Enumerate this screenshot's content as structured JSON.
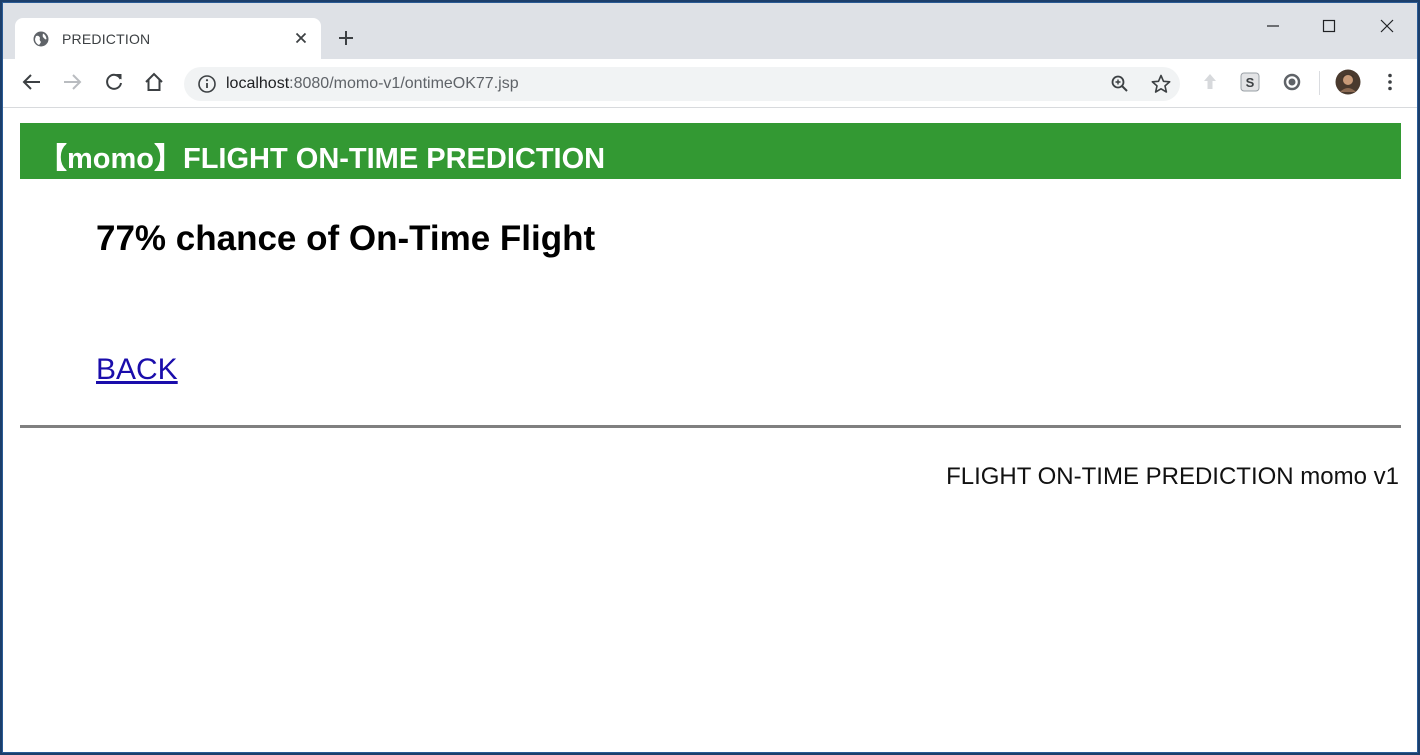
{
  "browser": {
    "tab": {
      "title": "PREDICTION",
      "favicon": "globe-icon"
    },
    "url": {
      "host": "localhost",
      "path": ":8080/momo-v1/ontimeOK77.jsp"
    },
    "toolbar_icons": [
      "back-icon",
      "forward-icon",
      "reload-icon",
      "home-icon",
      "info-icon",
      "zoom-icon",
      "star-icon",
      "extension-icon",
      "s-extension-icon",
      "circle-extension-icon",
      "avatar",
      "menu-icon"
    ]
  },
  "page": {
    "banner_title": "【momo】FLIGHT ON-TIME PREDICTION",
    "banner_color": "#339933",
    "result_text": "77% chance of On-Time Flight",
    "back_link": "BACK",
    "footer_text": "FLIGHT ON-TIME PREDICTION momo v1"
  }
}
